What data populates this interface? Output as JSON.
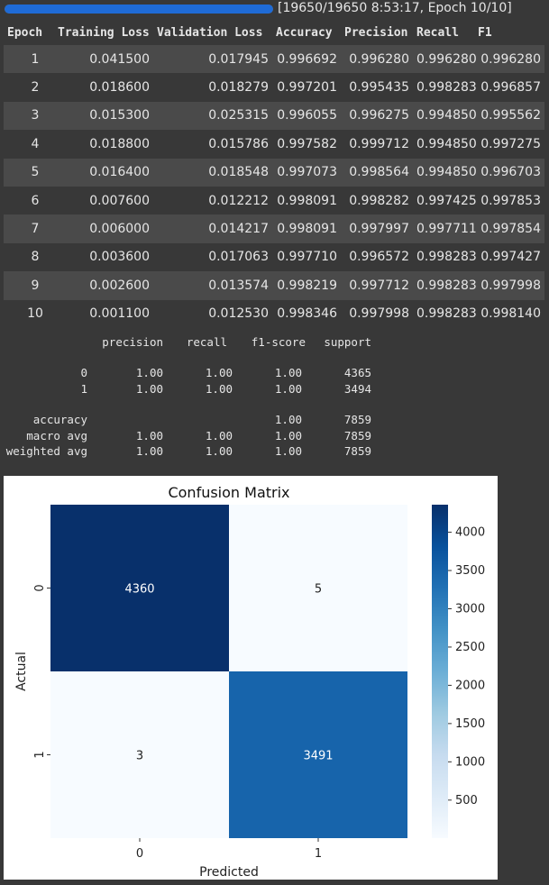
{
  "progress": {
    "text": "[19650/19650 8:53:17, Epoch 10/10]",
    "fraction": 1.0,
    "color": "#1f6bd6"
  },
  "train_table": {
    "headers": [
      "Epoch",
      "Training Loss",
      "Validation Loss",
      "Accuracy",
      "Precision",
      "Recall",
      "F1"
    ],
    "rows": [
      [
        "1",
        "0.041500",
        "0.017945",
        "0.996692",
        "0.996280",
        "0.996280",
        "0.996280"
      ],
      [
        "2",
        "0.018600",
        "0.018279",
        "0.997201",
        "0.995435",
        "0.998283",
        "0.996857"
      ],
      [
        "3",
        "0.015300",
        "0.025315",
        "0.996055",
        "0.996275",
        "0.994850",
        "0.995562"
      ],
      [
        "4",
        "0.018800",
        "0.015786",
        "0.997582",
        "0.999712",
        "0.994850",
        "0.997275"
      ],
      [
        "5",
        "0.016400",
        "0.018548",
        "0.997073",
        "0.998564",
        "0.994850",
        "0.996703"
      ],
      [
        "6",
        "0.007600",
        "0.012212",
        "0.998091",
        "0.998282",
        "0.997425",
        "0.997853"
      ],
      [
        "7",
        "0.006000",
        "0.014217",
        "0.998091",
        "0.997997",
        "0.997711",
        "0.997854"
      ],
      [
        "8",
        "0.003600",
        "0.017063",
        "0.997710",
        "0.996572",
        "0.998283",
        "0.997427"
      ],
      [
        "9",
        "0.002600",
        "0.013574",
        "0.998219",
        "0.997712",
        "0.998283",
        "0.997998"
      ],
      [
        "10",
        "0.001100",
        "0.012530",
        "0.998346",
        "0.997998",
        "0.998283",
        "0.998140"
      ]
    ]
  },
  "report": {
    "headers": [
      "precision",
      "recall",
      "f1-score",
      "support"
    ],
    "rows": [
      {
        "label": "0",
        "precision": "1.00",
        "recall": "1.00",
        "f1": "1.00",
        "support": "4365"
      },
      {
        "label": "1",
        "precision": "1.00",
        "recall": "1.00",
        "f1": "1.00",
        "support": "3494"
      },
      {
        "label": "accuracy",
        "precision": "",
        "recall": "",
        "f1": "1.00",
        "support": "7859"
      },
      {
        "label": "macro avg",
        "precision": "1.00",
        "recall": "1.00",
        "f1": "1.00",
        "support": "7859"
      },
      {
        "label": "weighted avg",
        "precision": "1.00",
        "recall": "1.00",
        "f1": "1.00",
        "support": "7859"
      }
    ]
  },
  "chart_data": {
    "type": "heatmap",
    "title": "Confusion Matrix",
    "xlabel": "Predicted",
    "ylabel": "Actual",
    "x_categories": [
      "0",
      "1"
    ],
    "y_categories": [
      "0",
      "1"
    ],
    "values": [
      [
        4360,
        5
      ],
      [
        3,
        3491
      ]
    ],
    "colorbar": {
      "ticks": [
        500,
        1000,
        1500,
        2000,
        2500,
        3000,
        3500,
        4000
      ],
      "min": 3,
      "max": 4360,
      "colormap": "Blues"
    },
    "colors": {
      "low": "#f7fbff",
      "high": "#08306b"
    }
  }
}
